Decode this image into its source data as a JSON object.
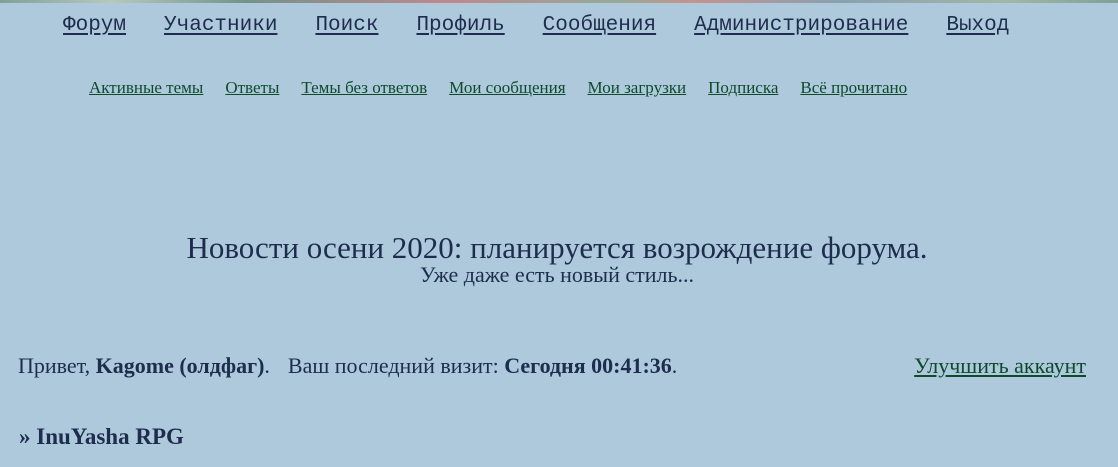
{
  "main_nav": {
    "items": [
      {
        "label": "Форум"
      },
      {
        "label": "Участники"
      },
      {
        "label": "Поиск"
      },
      {
        "label": "Профиль"
      },
      {
        "label": "Сообщения"
      },
      {
        "label": "Администрирование"
      },
      {
        "label": "Выход"
      }
    ]
  },
  "sub_nav": {
    "items": [
      {
        "label": "Активные темы"
      },
      {
        "label": "Ответы"
      },
      {
        "label": "Темы без ответов"
      },
      {
        "label": "Мои сообщения"
      },
      {
        "label": "Мои загрузки"
      },
      {
        "label": "Подписка"
      },
      {
        "label": "Всё прочитано"
      }
    ]
  },
  "announcement": {
    "title": "Новости осени 2020: планируется возрождение форума.",
    "subtitle": "Уже даже есть новый стиль..."
  },
  "welcome": {
    "greeting": "Привет,",
    "username": "Kagome (олдфаг)",
    "punct_after_user": ".",
    "last_visit_label": "Ваш последний визит:",
    "last_visit_value": "Сегодня 00:41:36",
    "punct_end": "."
  },
  "upgrade_link": "Улучшить аккаунт",
  "breadcrumb": {
    "prefix": "»",
    "forum_title": "InuYasha RPG"
  },
  "colors": {
    "background": "#adc9db",
    "text": "#1e2d4e",
    "link_green": "#0f4a2c"
  }
}
